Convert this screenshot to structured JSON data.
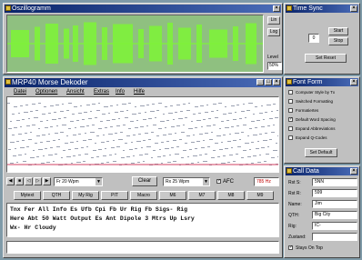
{
  "oscillogram": {
    "title": "Oszillogramm",
    "side_buttons": [
      "Lin",
      "Log"
    ],
    "level_label": "Level",
    "level_value": "50%"
  },
  "timesync": {
    "title": "Time Sync",
    "time_value": "0",
    "start_label": "Start",
    "stop_label": "Stop",
    "apply_label": "Set Reset"
  },
  "decoder": {
    "title": "MRP40 Morse Dekoder",
    "menu": [
      "Datei",
      "Optionen",
      "Ansicht",
      "Extras",
      "Info",
      "Hilfe"
    ],
    "speed_left": "Fr 20 Wpm",
    "center_button": "Clear",
    "speed_right": "Rx 25 Wpm",
    "afc_label": "AFC",
    "freq_value": "785 Hz",
    "macros": [
      "Mytext",
      "QTH",
      "My Rig",
      "PIT",
      "Macro",
      "M6",
      "M7",
      "M8",
      "M9"
    ],
    "decoded_lines": [
      "Tnx Fer All Info Es Ufb Cpi Fb Ur Rig Fb Sigs- Rig",
      "Here Abt 50 Watt Output Es Ant Dipole 3 Mtrs Up Lsry",
      "Wx- Hr Cloudy"
    ]
  },
  "fonts": {
    "title": "Font Form",
    "options": [
      "Computer Style by Tx",
      "Switched Formatting",
      "Formatiertes",
      "Default Word Spacing",
      "Expand Abbreviations",
      "Expand Q-Codes"
    ],
    "checked": [
      false,
      false,
      false,
      true,
      false,
      false
    ],
    "button": "Set Default"
  },
  "qso": {
    "title": "Call Data",
    "fields": [
      {
        "label": "Rst S:",
        "value": "5NN"
      },
      {
        "label": "Rst R:",
        "value": "599"
      },
      {
        "label": "Name:",
        "value": "Jim"
      },
      {
        "label": "QTH:",
        "value": "Big City"
      },
      {
        "label": "Rig:",
        "value": "IC-"
      }
    ],
    "extra_label": "Zustand:",
    "ontop_label": "Stays On Top"
  },
  "colors": {
    "title_start": "#0a246a",
    "title_end": "#4a6cb8",
    "scope_bg": "#8fc080",
    "scope_trace": "#7ef23a",
    "desktop": "#7f9aa8"
  }
}
